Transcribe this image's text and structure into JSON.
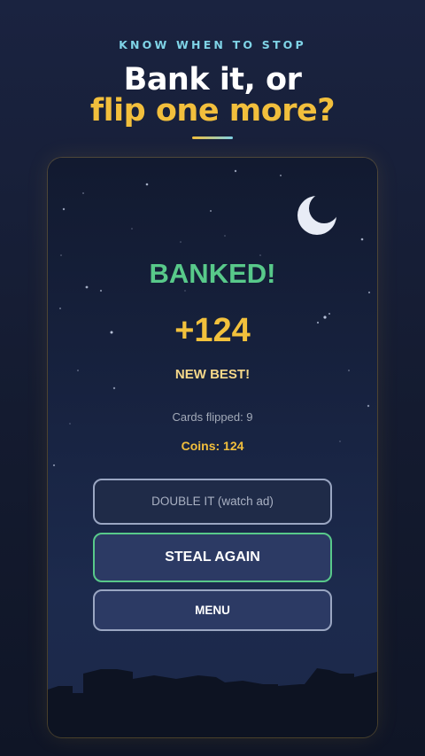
{
  "header": {
    "kicker": "KNOW WHEN TO STOP",
    "title_line1": "Bank it, or",
    "title_line2": "flip one more?"
  },
  "result": {
    "status": "BANKED!",
    "amount": "+124",
    "badge": "NEW BEST!",
    "cards_flipped": "Cards flipped: 9",
    "coins": "Coins: 124"
  },
  "buttons": {
    "double": "DOUBLE IT (watch ad)",
    "steal": "STEAL AGAIN",
    "menu": "MENU"
  },
  "colors": {
    "accent_gold": "#f2bf3c",
    "success_green": "#58c98a",
    "kicker_cyan": "#7fd3e6",
    "button_fill": "#2c3a64"
  },
  "icons": {
    "moon": "crescent-moon-icon"
  }
}
